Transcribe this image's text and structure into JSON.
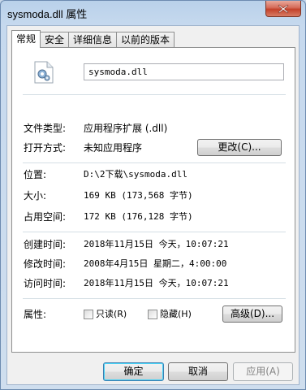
{
  "window": {
    "title": "sysmoda.dll 属性"
  },
  "tabs": [
    "常规",
    "安全",
    "详细信息",
    "以前的版本"
  ],
  "file": {
    "name": "sysmoda.dll"
  },
  "fields": {
    "type_label": "文件类型:",
    "type_value": "应用程序扩展 (.dll)",
    "open_label": "打开方式:",
    "open_value": "未知应用程序",
    "change_button": "更改(C)...",
    "location_label": "位置:",
    "location_value": "D:\\2下载\\sysmoda.dll",
    "size_label": "大小:",
    "size_value": "169 KB (173,568 字节)",
    "disk_label": "占用空间:",
    "disk_value": "172 KB (176,128 字节)",
    "created_label": "创建时间:",
    "created_value": "2018年11月15日 今天，10:07:21",
    "modified_label": "修改时间:",
    "modified_value": "2008年4月15日 星期二，4:00:00",
    "accessed_label": "访问时间:",
    "accessed_value": "2018年11月15日 今天，10:07:21",
    "attributes_label": "属性:",
    "readonly_label": "只读(R)",
    "hidden_label": "隐藏(H)",
    "advanced_button": "高级(D)..."
  },
  "buttons": {
    "ok": "确定",
    "cancel": "取消",
    "apply": "应用(A)"
  }
}
